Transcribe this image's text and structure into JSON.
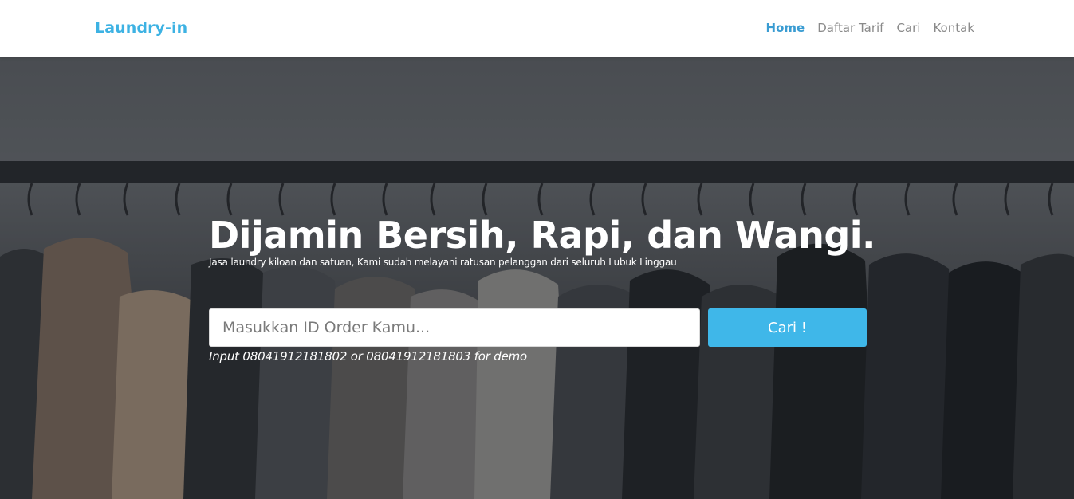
{
  "navbar": {
    "brand": "Laundry-in",
    "links": [
      {
        "label": "Home",
        "active": true
      },
      {
        "label": "Daftar Tarif",
        "active": false
      },
      {
        "label": "Cari",
        "active": false
      },
      {
        "label": "Kontak",
        "active": false
      }
    ]
  },
  "hero": {
    "title": "Dijamin Bersih, Rapi, dan Wangi.",
    "subtitle": "Jasa laundry kiloan dan satuan, Kami sudah melayani ratusan pelanggan dari seluruh Lubuk Linggau",
    "search": {
      "placeholder": "Masukkan ID Order Kamu...",
      "value": "",
      "button_label": "Cari !"
    },
    "demo_hint": "Input 08041912181802 or 08041912181803 for demo"
  },
  "colors": {
    "brand": "#3db2e3",
    "nav_active": "#3a9cd2",
    "nav_inactive": "#8a8a8a",
    "button": "#3fb7e9"
  }
}
